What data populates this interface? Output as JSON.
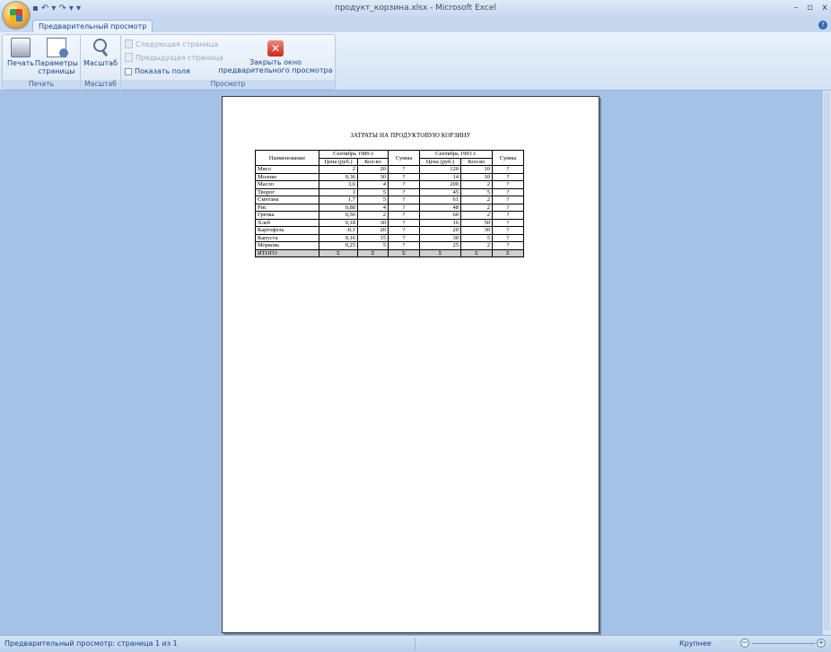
{
  "window": {
    "title": "продукт_корзина.xlsx - Microsoft Excel",
    "minimize": "–",
    "restore": "▫",
    "close": "x"
  },
  "qat": {
    "save": "▪",
    "undo": "↶ ▾",
    "redo": "↷ ▾",
    "customize": "▾"
  },
  "tabs": [
    {
      "label": "Предварительный просмотр",
      "active": true
    }
  ],
  "help": "?",
  "ribbon": {
    "groups": [
      {
        "label": "Печать",
        "buttons": [
          "Печать",
          "Параметры страницы"
        ]
      },
      {
        "label": "Масштаб",
        "buttons": [
          "Масштаб"
        ]
      },
      {
        "label": "Просмотр"
      }
    ],
    "print_label": "Печать",
    "page_setup_label_1": "Параметры",
    "page_setup_label_2": "страницы",
    "zoom_label": "Масштаб",
    "next_page": "Следующая страница",
    "prev_page": "Предыдущая страница",
    "show_margins": "Показать поля",
    "close_preview_1": "Закрыть окно",
    "close_preview_2": "предварительного просмотра",
    "close_icon_glyph": "✕"
  },
  "document": {
    "title": "ЗАТРАТЫ НА ПРОДУКТОВУЮ КОРЗИНУ",
    "headers": {
      "name": "Наименование",
      "period1": "Сентябрь 1989 г.",
      "period2": "Сентябрь 1993 г.",
      "price": "Цена (руб.)",
      "qty": "Кол-во",
      "sum": "Сумма"
    },
    "rows": [
      {
        "name": "Мясо",
        "p1": "2",
        "q1": "20",
        "s1": "?",
        "p2": "120",
        "q2": "10",
        "s2": "?"
      },
      {
        "name": "Молоко",
        "p1": "0,36",
        "q1": "30",
        "s1": "?",
        "p2": "14",
        "q2": "10",
        "s2": "?"
      },
      {
        "name": "Масло",
        "p1": "3,6",
        "q1": "4",
        "s1": "?",
        "p2": "200",
        "q2": "2",
        "s2": "?"
      },
      {
        "name": "Творог",
        "p1": "1",
        "q1": "5",
        "s1": "?",
        "p2": "45",
        "q2": "5",
        "s2": "?"
      },
      {
        "name": "Сметана",
        "p1": "1,7",
        "q1": "5",
        "s1": "?",
        "p2": "61",
        "q2": "2",
        "s2": "?"
      },
      {
        "name": "Рис",
        "p1": "0,88",
        "q1": "4",
        "s1": "?",
        "p2": "48",
        "q2": "2",
        "s2": "?"
      },
      {
        "name": "Гречка",
        "p1": "0,56",
        "q1": "2",
        "s1": "?",
        "p2": "60",
        "q2": "2",
        "s2": "?"
      },
      {
        "name": "Хлеб",
        "p1": "0,18",
        "q1": "30",
        "s1": "?",
        "p2": "16",
        "q2": "50",
        "s2": "?"
      },
      {
        "name": "Картофель",
        "p1": "-0,1",
        "q1": "20",
        "s1": "?",
        "p2": "20",
        "q2": "30",
        "s2": "?"
      },
      {
        "name": "Капуста",
        "p1": "0,16",
        "q1": "15",
        "s1": "?",
        "p2": "30",
        "q2": "5",
        "s2": "?"
      },
      {
        "name": "Морковь",
        "p1": "0,25",
        "q1": "5",
        "s1": "?",
        "p2": "25",
        "q2": "2",
        "s2": "?"
      }
    ],
    "total": {
      "name": "ИТОГО",
      "p1": "Σ",
      "q1": "Σ",
      "s1": "Σ",
      "p2": "Σ",
      "q2": "Σ",
      "s2": "Σ"
    }
  },
  "status": {
    "text": "Предварительный просмотр: страница 1 из 1",
    "zoom_label": "Крупнее",
    "zoom_percent": "100%",
    "zoom_out": "−",
    "zoom_in": "+"
  },
  "colors": {
    "workspace": "#a4c2e6",
    "ribbon_text": "#15428b",
    "total_row": "#cfcfcf"
  }
}
